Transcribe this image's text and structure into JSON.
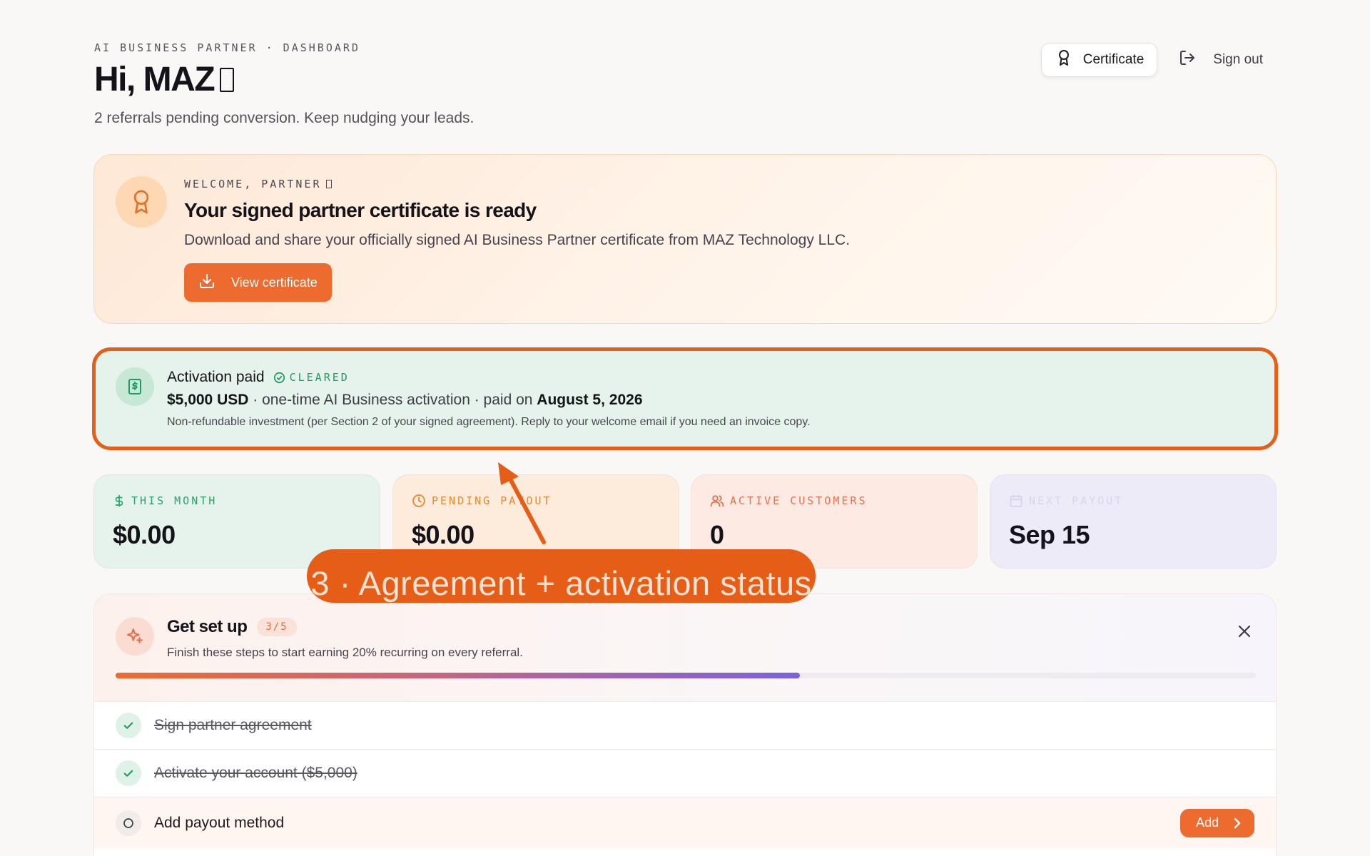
{
  "header": {
    "eyebrow": "AI BUSINESS PARTNER · DASHBOARD",
    "greeting": "Hi, MAZ",
    "subline": "2 referrals pending conversion. Keep nudging your leads.",
    "certificate_label": "Certificate",
    "signout_label": "Sign out"
  },
  "welcome": {
    "eyebrow": "WELCOME, PARTNER",
    "title": "Your signed partner certificate is ready",
    "description": "Download and share your officially signed AI Business Partner certificate from MAZ Technology LLC.",
    "button_label": "View certificate"
  },
  "activation": {
    "title": "Activation paid",
    "badge": "CLEARED",
    "amount": "$5,000 USD",
    "detail": " · one-time AI Business activation · paid on ",
    "date": "August 5, 2026",
    "note": "Non-refundable investment (per Section 2 of your signed agreement). Reply to your welcome email if you need an invoice copy."
  },
  "stats": [
    {
      "label": "THIS MONTH",
      "value": "$0.00",
      "icon": "dollar-icon"
    },
    {
      "label": "PENDING PAYOUT",
      "value": "$0.00",
      "icon": "clock-icon"
    },
    {
      "label": "ACTIVE CUSTOMERS",
      "value": "0",
      "icon": "users-icon"
    },
    {
      "label": "NEXT PAYOUT",
      "value": "Sep 15",
      "icon": "calendar-icon"
    }
  ],
  "setup": {
    "title": "Get set up",
    "count": "3/5",
    "subtitle": "Finish these steps to start earning 20% recurring on every referral.",
    "progress": 0.6,
    "steps": [
      {
        "label": "Sign partner agreement",
        "done": true
      },
      {
        "label": "Activate your account ($5,000)",
        "done": true
      },
      {
        "label": "Add payout method",
        "done": false
      }
    ],
    "add_label": "Add"
  },
  "annotation": {
    "text": "3 · Agreement + activation status"
  },
  "colors": {
    "accent": "#ee6b2f",
    "success": "#1e9b62",
    "highlight": "#e4601a"
  }
}
